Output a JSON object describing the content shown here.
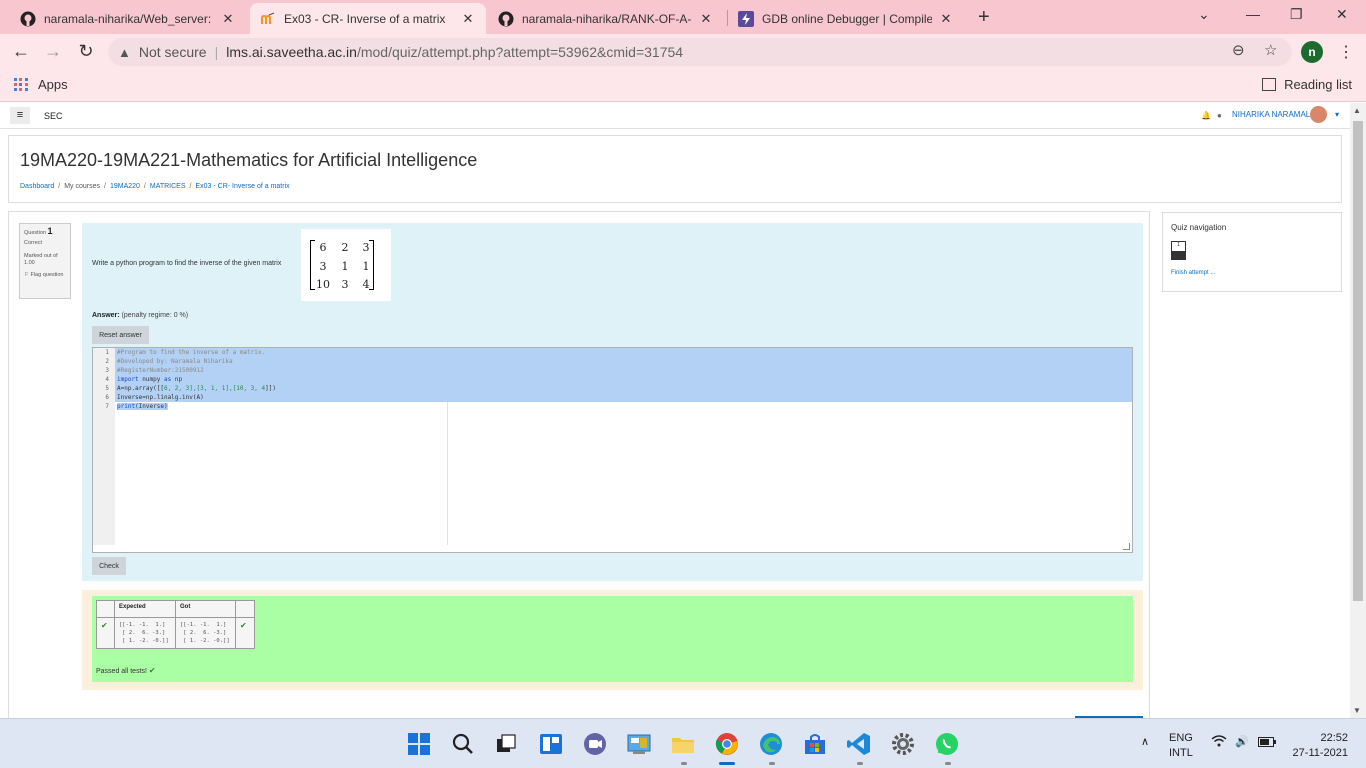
{
  "browser": {
    "tabs": [
      {
        "title": "naramala-niharika/Web_server: C",
        "icon": "github-icon",
        "active": false
      },
      {
        "title": "Ex03 - CR- Inverse of a matrix",
        "icon": "moodle-icon",
        "active": true
      },
      {
        "title": "naramala-niharika/RANK-OF-A-M",
        "icon": "github-icon",
        "active": false
      },
      {
        "title": "GDB online Debugger | Compiler",
        "icon": "gdb-icon",
        "active": false
      }
    ],
    "security_label": "Not secure",
    "url_host": "lms.ai.saveetha.ac.in",
    "url_path": "/mod/quiz/attempt.php?attempt=53962&cmid=31754",
    "profile_initial": "n",
    "bookmarks": {
      "apps": "Apps",
      "reading_list": "Reading list"
    }
  },
  "site": {
    "short_name": "SEC",
    "user_name": "NIHARIKA NARAMALA"
  },
  "course": {
    "title": "19MA220-19MA221-Mathematics for Artificial Intelligence",
    "breadcrumb": [
      "Dashboard",
      "My courses",
      "19MA220",
      "MATRICES",
      "Ex03 - CR- Inverse of a matrix"
    ]
  },
  "question": {
    "label": "Question",
    "number": "1",
    "status": "Correct",
    "marked_out_of": "Marked out of",
    "marks": "1.00",
    "flag": "Flag question",
    "text": "Write a python program to find the inverse of the given matrix",
    "matrix": [
      [
        "6",
        "2",
        "3"
      ],
      [
        "3",
        "1",
        "1"
      ],
      [
        "10",
        "3",
        "4"
      ]
    ],
    "answer_label": "Answer:",
    "penalty": "(penalty regime: 0 %)",
    "reset_button": "Reset answer",
    "check_button": "Check"
  },
  "code": {
    "line_numbers": [
      "1",
      "2",
      "3",
      "4",
      "5",
      "6",
      "7"
    ],
    "line1": "#Program to find the inverse of a matrix.",
    "line2": "#Developed by: Naramala Niharika",
    "line3": "#RegisterNumber:21500912",
    "line4_kw1": "import",
    "line4_mid": " numpy ",
    "line4_kw2": "as",
    "line4_end": " np",
    "line5_start": "A=np.array([[",
    "line5_nums": "6, 2, 3],[3, 1, 1],[10, 3, 4",
    "line5_end": "]])",
    "line6": "Inverse=np.linalg.inv(A)",
    "line7_kw": "print",
    "line7_end": "(Inverse)"
  },
  "result": {
    "header_expected": "Expected",
    "header_got": "Got",
    "expected": "[[-1. -1.  1.]\n [ 2.  6. -3.]\n [ 1. -2. -0.]]",
    "got": "[[-1. -1.  1.]\n [ 2.  6. -3.]\n [ 1. -2. -0.]]",
    "passed": "Passed all tests!"
  },
  "quiz_nav": {
    "title": "Quiz navigation",
    "question_button": "1",
    "finish": "Finish attempt ..."
  },
  "taskbar": {
    "lang": "ENG",
    "layout": "INTL",
    "time": "22:52",
    "date": "27-11-2021"
  },
  "colors": {
    "tab_strip": "#f8c6cf",
    "link": "#0f6cbf",
    "question_bg": "#def2f8",
    "result_bg": "#aaffa4"
  }
}
